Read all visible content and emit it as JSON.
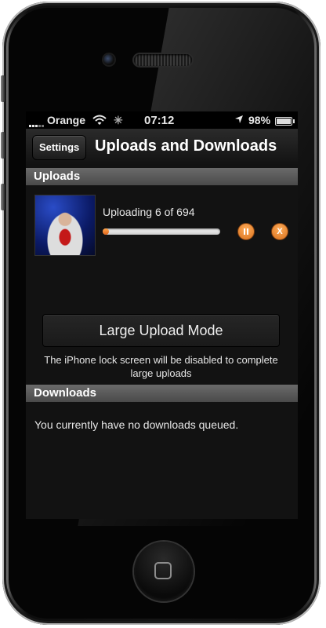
{
  "status_bar": {
    "carrier": "Orange",
    "time": "07:12",
    "battery_percent": "98%",
    "battery_level": 0.98,
    "icons": [
      "signal-icon",
      "wifi-icon",
      "activity-spinner-icon",
      "location-arrow-icon",
      "battery-icon"
    ]
  },
  "navbar": {
    "back_label": "Settings",
    "title": "Uploads and Downloads"
  },
  "uploads": {
    "header": "Uploads",
    "status_text": "Uploading 6 of 694",
    "progress": 0.02,
    "pause_icon": "pause-icon",
    "cancel_label": "X",
    "large_mode_label": "Large Upload Mode",
    "note": "The iPhone lock screen will be disabled to complete large uploads"
  },
  "downloads": {
    "header": "Downloads",
    "empty_text": "You currently have no downloads queued."
  },
  "colors": {
    "accent": "#f28b2c",
    "section_header": "#555555",
    "background": "#121212"
  }
}
